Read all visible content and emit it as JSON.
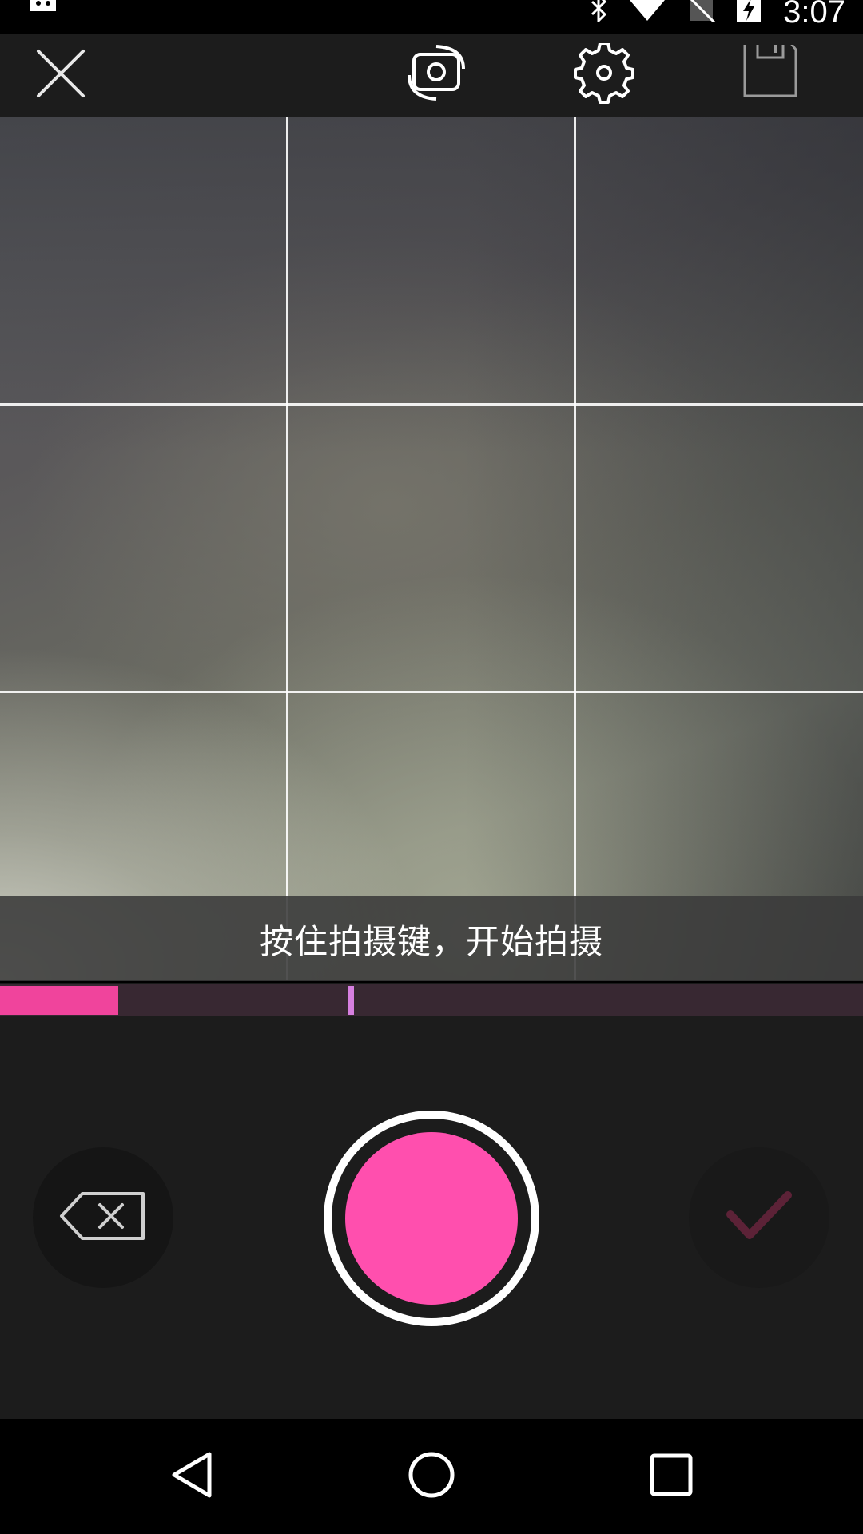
{
  "status_bar": {
    "time": "3:07",
    "icons": [
      "android-notification-icon",
      "bluetooth-icon",
      "wifi-icon",
      "no-sim-icon",
      "battery-charging-icon"
    ]
  },
  "toolbar": {
    "icons": [
      "close-icon",
      "switch-camera-icon",
      "settings-icon",
      "save-icon"
    ]
  },
  "camera": {
    "grid": "3x3"
  },
  "hint": {
    "text": "按住拍摄键，开始拍摄"
  },
  "progress": {
    "recorded_fraction": 0.137,
    "min_duration_marker_fraction": 0.403,
    "fill_color": "#f0449c",
    "marker_color": "#d77fe0"
  },
  "controls": {
    "delete_icon": "backspace-icon",
    "record_color": "#ff4fae",
    "confirm_icon": "checkmark-icon",
    "confirm_color": "#5c2237"
  },
  "nav_bar": {
    "icons": [
      "back-icon",
      "home-icon",
      "recents-icon"
    ]
  }
}
